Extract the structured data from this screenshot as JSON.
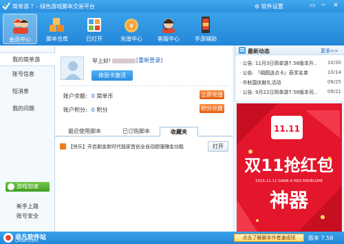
{
  "window": {
    "title": "简单游 ？- 绿色游戏脚本交易平台",
    "settings_label": "软件设置",
    "min_glyph": "▭",
    "max_glyph": "─",
    "close_glyph": "✕"
  },
  "toolbar": {
    "items": [
      {
        "label": "会员中心",
        "icon": "member-icon"
      },
      {
        "label": "脚本仓库",
        "icon": "script-warehouse-icon"
      },
      {
        "label": "已打开",
        "icon": "opened-icon"
      },
      {
        "label": "充值中心",
        "icon": "recharge-icon"
      },
      {
        "label": "客服中心",
        "icon": "customer-service-icon"
      },
      {
        "label": "手游辅助",
        "icon": "mobile-game-icon"
      }
    ]
  },
  "sidebar": {
    "items": [
      {
        "label": "我的简单游"
      },
      {
        "label": "账号信息"
      },
      {
        "label": "短消息"
      },
      {
        "label": "我的问题"
      }
    ],
    "accelerate_label": "游戏加速",
    "links": [
      "新手上路",
      "账号安全"
    ]
  },
  "user": {
    "greeting_prefix": "早上好!",
    "relogin": "[重新登录]",
    "activate_btn": "体验卡激活"
  },
  "account": {
    "balance_label": "账户余额:",
    "balance_value": "0",
    "balance_unit": "简单币",
    "points_label": "账户积分:",
    "points_value": "0",
    "points_unit": "积分",
    "recharge_btn": "立即充值",
    "exchange_btn": "积分兑换"
  },
  "tabs": [
    {
      "label": "最近使用脚本"
    },
    {
      "label": "已订购脚本"
    },
    {
      "label": "收藏夹"
    }
  ],
  "favorites": [
    {
      "text": "【快乐】开启掘金新时代独家首创全自动超强赚金功能",
      "button": "打开"
    }
  ],
  "news": {
    "title": "最新动态",
    "more": "更多>>",
    "items": [
      {
        "title": "· 公告: 11月3日简单游7.58版本升..",
        "date": "10/30"
      },
      {
        "title": "· 公告: 『绸圆送点卡』获奖名单",
        "date": "10/14"
      },
      {
        "title": "· 中秋国庆献礼活动",
        "date": "09/25"
      },
      {
        "title": "· 公告: 9月22日简单游7.58版本司..",
        "date": "09/21"
      }
    ]
  },
  "ad": {
    "date_badge": "11.11",
    "headline": "双11抢红包",
    "sub": "2015.11.11 GRAB A RED ENVELOPE",
    "product": "神器"
  },
  "status": {
    "brand_cn": "非凡软件站",
    "brand_en": "CRSKY.com",
    "tutorial_btn": "点击了解脚本作者速成班",
    "version": "版本 7.58"
  },
  "colors": {
    "titlebar": "#2b8fe0",
    "accent_orange": "#e45e10",
    "ad_red": "#e3162c",
    "link_blue": "#1b63b4"
  }
}
